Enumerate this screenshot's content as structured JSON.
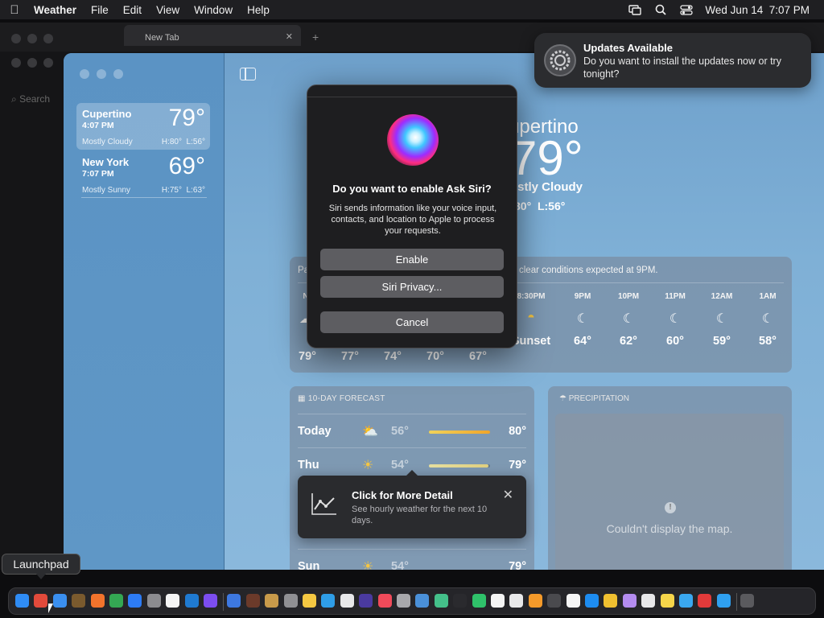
{
  "menubar": {
    "app": "Weather",
    "items": [
      "File",
      "Edit",
      "View",
      "Window",
      "Help"
    ],
    "datetime": "Wed Jun 14  7:07 PM"
  },
  "browser": {
    "tab_title": "New Tab",
    "search_placeholder": "Search"
  },
  "weather": {
    "locations": [
      {
        "city": "Cupertino",
        "time": "4:07 PM",
        "temp": "79°",
        "condition": "Mostly Cloudy",
        "hilo": "H:80°  L:56°"
      },
      {
        "city": "New York",
        "time": "7:07 PM",
        "temp": "69°",
        "condition": "Mostly Sunny",
        "hilo": "H:75°  L:63°"
      }
    ],
    "hero": {
      "city": "upertino",
      "temp": "79°",
      "condition": "ostly Cloudy",
      "hilo": "80°  L:56°"
    },
    "hourly": {
      "note_left": "Pa",
      "note": "clear conditions expected at 9PM.",
      "now_label": "N",
      "hours": [
        {
          "label": "8:30PM",
          "value": "Sunset"
        },
        {
          "label": "9PM",
          "value": "64°"
        },
        {
          "label": "10PM",
          "value": "62°"
        },
        {
          "label": "11PM",
          "value": "60°"
        },
        {
          "label": "12AM",
          "value": "59°"
        },
        {
          "label": "1AM",
          "value": "58°"
        }
      ],
      "left_temps": [
        "79°",
        "77°",
        "74°",
        "70°",
        "67°"
      ]
    },
    "forecast": {
      "header": "10-DAY FORECAST",
      "rows": [
        {
          "day": "Today",
          "lo": "56°",
          "hi": "80°"
        },
        {
          "day": "Thu",
          "lo": "54°",
          "hi": "79°"
        },
        {
          "day": "Sun",
          "lo": "54°",
          "hi": "79°"
        }
      ]
    },
    "precipitation": {
      "header": "PRECIPITATION",
      "message": "Couldn't display the map."
    },
    "detail_tip": {
      "title": "Click for More Detail",
      "desc": "See hourly weather for the next 10 days."
    }
  },
  "siri": {
    "title": "Do you want to enable Ask Siri?",
    "body": "Siri sends information like your voice input, contacts, and location to Apple to process your requests.",
    "enable": "Enable",
    "privacy": "Siri Privacy...",
    "cancel": "Cancel"
  },
  "notification": {
    "title": "Updates Available",
    "body": "Do you want to install the updates now or try tonight?"
  },
  "dock": {
    "tooltip": "Launchpad",
    "icon_colors": [
      "#2f8cf5",
      "#e24a3b",
      "#3a8ff0",
      "#7a5a2e",
      "#f2732c",
      "#34a853",
      "#2d7cf6",
      "#8c8c90",
      "#f5f5f5",
      "#1f7ad1",
      "#7c4df0",
      "#3d78e0",
      "#6b3a2a",
      "#c89a4a",
      "#909094",
      "#f5c842",
      "#2f9ee8",
      "#e8e8ea",
      "#4a3aa0",
      "#f04a5a",
      "#a8a8ac",
      "#4a90d9",
      "#44c08a",
      "#2a2a2e",
      "#2fc26a",
      "#f5f5f5",
      "#e8e8ea",
      "#f59a2a",
      "#4a4a4e",
      "#f5f5f5",
      "#1d8cf0",
      "#f0c030",
      "#b48cf0",
      "#e8e8ea",
      "#f5d54a",
      "#3aa8f0",
      "#e23a3a",
      "#2fa0f0",
      "#5a5a5e"
    ]
  }
}
